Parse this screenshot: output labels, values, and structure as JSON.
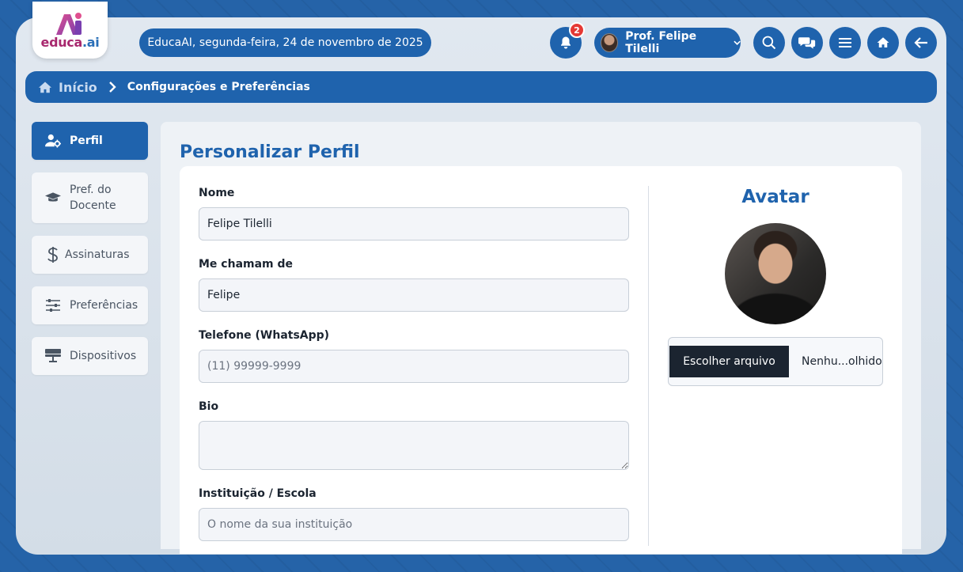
{
  "brand": {
    "name": "educa",
    "suffix": ".ai",
    "mark": "Ai"
  },
  "header": {
    "date_text": "EducaAI, segunda-feira, 24 de novembro de 2025",
    "notifications_count": "2",
    "user_name": "Prof. Felipe Tilelli"
  },
  "breadcrumb": {
    "home": "Início",
    "current": "Configurações e Preferências"
  },
  "sidebar": {
    "items": [
      {
        "label": "Perfil",
        "icon": "user-gear-icon"
      },
      {
        "label": "Pref. do Docente",
        "icon": "graduation-cap-icon"
      },
      {
        "label": "Assinaturas",
        "icon": "dollar-icon"
      },
      {
        "label": "Preferências",
        "icon": "sliders-icon"
      },
      {
        "label": "Dispositivos",
        "icon": "monitor-icon"
      }
    ]
  },
  "main": {
    "title": "Personalizar Perfil",
    "fields": {
      "nome": {
        "label": "Nome",
        "value": "Felipe Tilelli"
      },
      "apelido": {
        "label": "Me chamam de",
        "value": "Felipe"
      },
      "telefone": {
        "label": "Telefone (WhatsApp)",
        "placeholder": "(11) 99999-9999"
      },
      "bio": {
        "label": "Bio",
        "placeholder": ""
      },
      "instituicao": {
        "label": "Instituição / Escola",
        "placeholder": "O nome da sua instituição"
      }
    },
    "avatar": {
      "title": "Avatar",
      "choose_file": "Escolher arquivo",
      "file_name": "Nenhu...olhido"
    }
  },
  "colors": {
    "primary": "#1f63ad",
    "badge": "#e53935",
    "dark": "#1b2430"
  }
}
